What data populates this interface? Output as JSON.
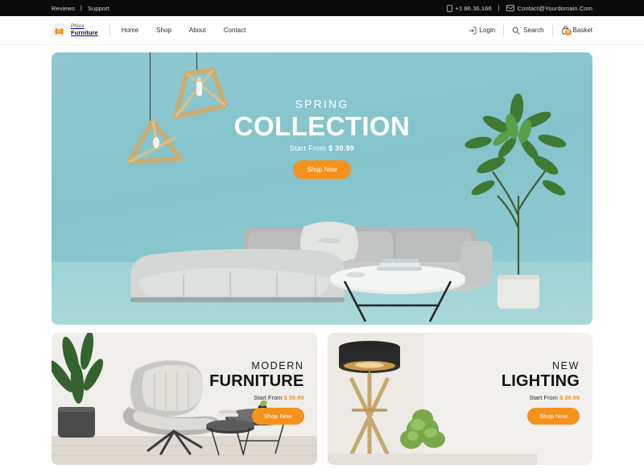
{
  "topbar": {
    "links": [
      {
        "label": "Reviews"
      },
      {
        "label": "Support"
      }
    ],
    "separator": "|",
    "phone": "+1 86.36.166",
    "email": "Contact@Yourdomain.Com",
    "phone_icon": "phone-icon",
    "email_icon": "mail-icon"
  },
  "header": {
    "brand": {
      "line1": "Phlox",
      "line2": "Furniture",
      "icon": "armchair-logo-icon"
    },
    "nav": [
      {
        "label": "Home"
      },
      {
        "label": "Shop"
      },
      {
        "label": "About"
      },
      {
        "label": "Contact"
      }
    ],
    "actions": {
      "login_label": "Login",
      "login_icon": "login-icon",
      "search_label": "Search",
      "search_icon": "search-icon",
      "basket_label": "Basket",
      "basket_icon": "basket-icon",
      "basket_count": "0"
    }
  },
  "hero": {
    "eyebrow": "SPRING",
    "title": "COLLECTION",
    "price_prefix": "Start From",
    "price": "$ 39.99",
    "button_label": "Shop Now",
    "background_color": "#86c5cc"
  },
  "cards": [
    {
      "eyebrow": "MODERN",
      "title": "FURNITURE",
      "price_prefix": "Start From",
      "price": "$ 39.99",
      "button_label": "Shop Now"
    },
    {
      "eyebrow": "NEW",
      "title": "LIGHTING",
      "price_prefix": "Start From",
      "price": "$ 39.99",
      "button_label": "Shop Now"
    }
  ],
  "theme": {
    "accent": "#f5921e",
    "dark": "#0a0a0a",
    "hero_teal": "#86c5cc"
  }
}
